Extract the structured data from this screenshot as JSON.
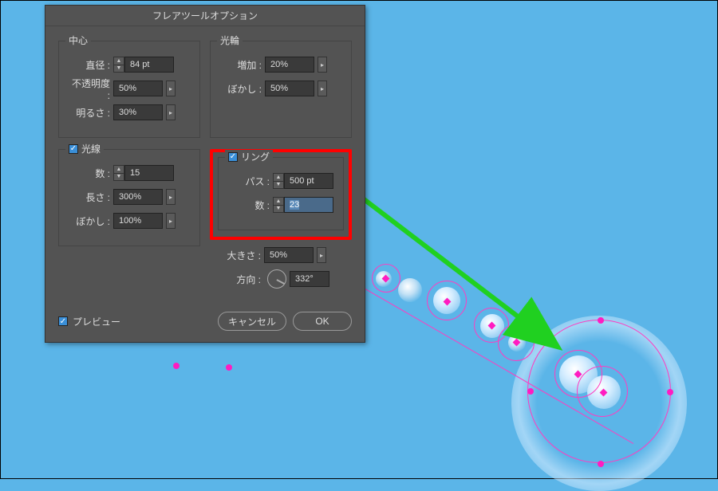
{
  "dialog": {
    "title": "フレアツールオプション",
    "center": {
      "title": "中心",
      "diameter_label": "直径 :",
      "diameter_value": "84 pt",
      "opacity_label": "不透明度 :",
      "opacity_value": "50%",
      "brightness_label": "明るさ :",
      "brightness_value": "30%"
    },
    "halo": {
      "title": "光輪",
      "growth_label": "増加 :",
      "growth_value": "20%",
      "fuzz_label": "ぼかし :",
      "fuzz_value": "50%"
    },
    "rays": {
      "title": "光線",
      "count_label": "数 :",
      "count_value": "15",
      "length_label": "長さ :",
      "length_value": "300%",
      "fuzz_label": "ぼかし :",
      "fuzz_value": "100%"
    },
    "rings": {
      "title": "リング",
      "path_label": "パス :",
      "path_value": "500 pt",
      "count_label": "数 :",
      "count_value": "23",
      "size_label": "大きさ :",
      "size_value": "50%",
      "direction_label": "方向 :",
      "direction_value": "332°"
    },
    "preview_label": "プレビュー",
    "cancel_label": "キャンセル",
    "ok_label": "OK"
  }
}
